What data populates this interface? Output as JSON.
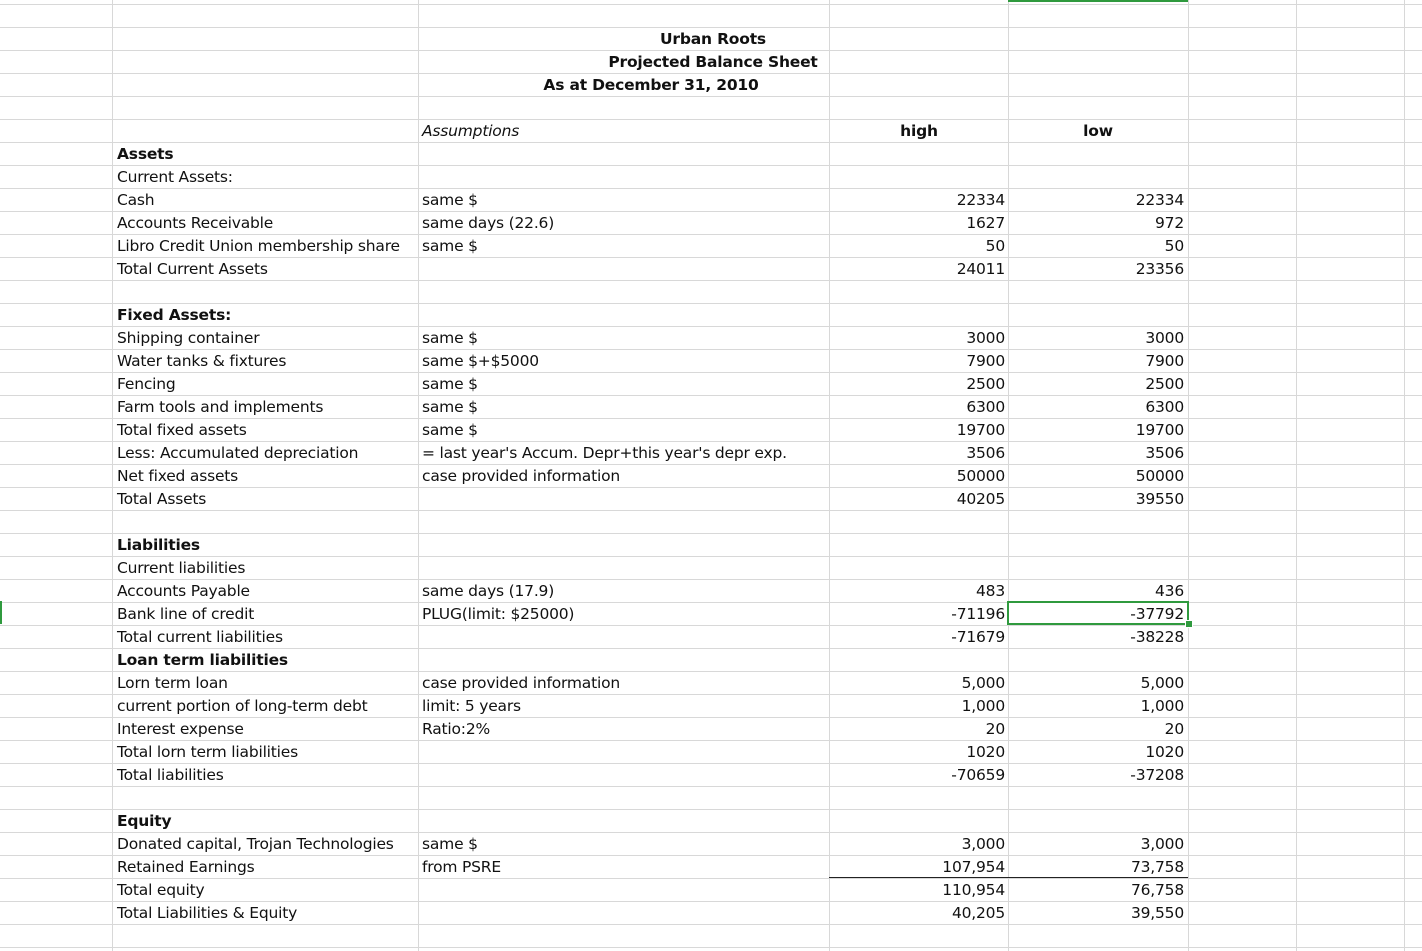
{
  "sheet": {
    "title": {
      "line1": "Urban Roots",
      "line2": "Projected Balance Sheet",
      "line3": "As at December 31, 2010"
    },
    "headers": {
      "assumptions": "Assumptions",
      "high": "high",
      "low": "low"
    },
    "rows": [
      {
        "label": "Assets",
        "bold": true
      },
      {
        "label": "Current Assets:"
      },
      {
        "label": "Cash",
        "assumption": "same $",
        "high": "22334",
        "low": "22334"
      },
      {
        "label": "Accounts Receivable",
        "assumption": "same days (22.6)",
        "high": "1627",
        "low": "972"
      },
      {
        "label": "Libro Credit Union membership share",
        "assumption": "same $",
        "high": "50",
        "low": "50"
      },
      {
        "label": "Total Current Assets",
        "high": "24011",
        "low": "23356"
      },
      {
        "label": ""
      },
      {
        "label": "Fixed Assets:",
        "bold": true
      },
      {
        "label": "Shipping container",
        "assumption": "same $",
        "high": "3000",
        "low": "3000"
      },
      {
        "label": "Water tanks & fixtures",
        "assumption": "same $+$5000",
        "high": "7900",
        "low": "7900"
      },
      {
        "label": "Fencing",
        "assumption": "same $",
        "high": "2500",
        "low": "2500"
      },
      {
        "label": "Farm tools and implements",
        "assumption": "same $",
        "high": "6300",
        "low": "6300"
      },
      {
        "label": "Total fixed assets",
        "assumption": "same $",
        "high": "19700",
        "low": "19700"
      },
      {
        "label": "Less: Accumulated depreciation",
        "assumption": "= last year's Accum. Depr+this year's depr exp.",
        "high": "3506",
        "low": "3506"
      },
      {
        "label": "Net fixed assets",
        "assumption": "case provided information",
        "high": "50000",
        "low": "50000"
      },
      {
        "label": "Total Assets",
        "high": "40205",
        "low": "39550"
      },
      {
        "label": ""
      },
      {
        "label": "Liabilities",
        "bold": true
      },
      {
        "label": "Current liabilities"
      },
      {
        "label": "Accounts Payable",
        "assumption": "same days (17.9)",
        "high": "483",
        "low": "436"
      },
      {
        "label": "Bank line of credit",
        "assumption": "PLUG(limit: $25000)",
        "high": "-71196",
        "low": "-37792"
      },
      {
        "label": "Total current liabilities",
        "high": "-71679",
        "low": "-38228"
      },
      {
        "label": "Loan term liabilities",
        "bold": true
      },
      {
        "label": "Lorn term loan",
        "assumption": "case provided information",
        "high": "5,000",
        "low": "5,000"
      },
      {
        "label": "current portion of long-term debt",
        "assumption": "limit: 5 years",
        "high": "1,000",
        "low": "1,000"
      },
      {
        "label": "Interest expense",
        "assumption": "Ratio:2%",
        "high": "20",
        "low": "20"
      },
      {
        "label": "Total lorn term liabilities",
        "high": "1020",
        "low": "1020"
      },
      {
        "label": "Total liabilities",
        "high": "-70659",
        "low": "-37208"
      },
      {
        "label": ""
      },
      {
        "label": "Equity",
        "bold": true
      },
      {
        "label": "Donated capital, Trojan Technologies",
        "assumption": "same $",
        "high": "3,000",
        "low": "3,000"
      },
      {
        "label": "Retained Earnings",
        "assumption": "from PSRE",
        "high": "107,954",
        "low": "73,758"
      },
      {
        "label": "Total equity",
        "high": "110,954",
        "low": "76,758"
      },
      {
        "label": "Total Liabilities & Equity",
        "high": "40,205",
        "low": "39,550"
      }
    ]
  }
}
